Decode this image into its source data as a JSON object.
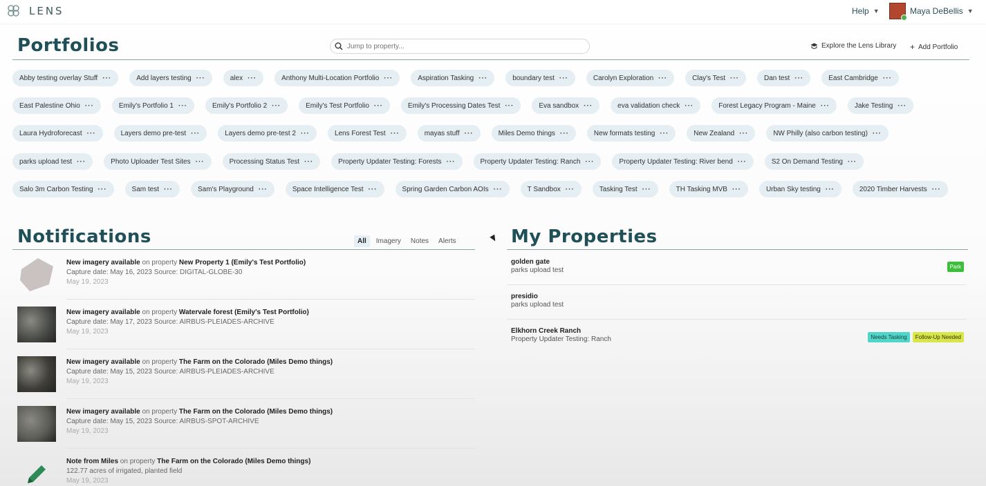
{
  "app": {
    "name": "LENS"
  },
  "topbar": {
    "help_label": "Help",
    "user_name": "Maya DeBellis"
  },
  "portfolios": {
    "title": "Portfolios",
    "search_placeholder": "Jump to property...",
    "library_label": "Explore the Lens Library",
    "add_label": "Add Portfolio",
    "rows": [
      [
        "Abby testing overlay Stuff",
        "Add layers testing",
        "alex",
        "Anthony Multi-Location Portfolio",
        "Aspiration Tasking",
        "boundary test",
        "Carolyn Exploration",
        "Clay's Test",
        "Dan test",
        "East Cambridge"
      ],
      [
        "East Palestine Ohio",
        "Emily's Portfolio 1",
        "Emily's Portfolio 2",
        "Emily's Test Portfolio",
        "Emily's Processing Dates Test",
        "Eva sandbox",
        "eva validation check",
        "Forest Legacy Program - Maine",
        "Jake Testing"
      ],
      [
        "Laura Hydroforecast",
        "Layers demo pre-test",
        "Layers demo pre-test 2",
        "Lens Forest Test",
        "mayas stuff",
        "Miles Demo things",
        "New formats testing",
        "New Zealand",
        "NW Philly (also carbon testing)"
      ],
      [
        "parks upload test",
        "Photo Uploader Test Sites",
        "Processing Status Test",
        "Property Updater Testing: Forests",
        "Property Updater Testing: Ranch",
        "Property Updater Testing: River bend",
        "S2 On Demand Testing"
      ],
      [
        "Salo 3m Carbon Testing",
        "Sam test",
        "Sam's Playground",
        "Space Intelligence Test",
        "Spring Garden Carbon AOIs",
        "T Sandbox",
        "Tasking Test",
        "TH Tasking MVB",
        "Urban Sky testing",
        "2020 Timber Harvests"
      ]
    ]
  },
  "notifications": {
    "title": "Notifications",
    "filters": [
      "All",
      "Imagery",
      "Notes",
      "Alerts"
    ],
    "items": [
      {
        "headline": "New imagery available",
        "connector": "on property",
        "property": "New Property 1 (Emily's Test Portfolio)",
        "line2_label": "Capture date:",
        "line2_value": "May 16, 2023",
        "source_label": "Source:",
        "source_value": "DIGITAL-GLOBE-30",
        "date": "May 19, 2023",
        "thumb_color": "#c9c2c0"
      },
      {
        "headline": "New imagery available",
        "connector": "on property",
        "property": "Watervale forest (Emily's Test Portfolio)",
        "line2_label": "Capture date:",
        "line2_value": "May 17, 2023",
        "source_label": "Source:",
        "source_value": "AIRBUS-PLEIADES-ARCHIVE",
        "date": "May 19, 2023",
        "thumb_color": "#4a4c49"
      },
      {
        "headline": "New imagery available",
        "connector": "on property",
        "property": "The Farm on the Colorado (Miles Demo things)",
        "line2_label": "Capture date:",
        "line2_value": "May 15, 2023",
        "source_label": "Source:",
        "source_value": "AIRBUS-PLEIADES-ARCHIVE",
        "date": "May 19, 2023",
        "thumb_color": "#3f3e38"
      },
      {
        "headline": "New imagery available",
        "connector": "on property",
        "property": "The Farm on the Colorado (Miles Demo things)",
        "line2_label": "Capture date:",
        "line2_value": "May 15, 2023",
        "source_label": "Source:",
        "source_value": "AIRBUS-SPOT-ARCHIVE",
        "date": "May 19, 2023",
        "thumb_color": "#5c5d57"
      },
      {
        "headline": "Note from Miles",
        "connector": "on property",
        "property": "The Farm on the Colorado (Miles Demo things)",
        "line2_label": "122.77 acres of irrigated, planted field",
        "line2_value": "",
        "source_label": "",
        "source_value": "",
        "date": "May 19, 2023",
        "thumb_color": ""
      }
    ]
  },
  "properties": {
    "title": "My Properties",
    "items": [
      {
        "name": "golden gate",
        "portfolio": "parks upload test",
        "tags": [
          {
            "label": "Park",
            "bg": "#3bbf3b",
            "fg": "#ffffff"
          }
        ]
      },
      {
        "name": "presidio",
        "portfolio": "parks upload test",
        "tags": []
      },
      {
        "name": "Elkhorn Creek Ranch",
        "portfolio": "Property Updater Testing: Ranch",
        "tags": [
          {
            "label": "Needs Tasking",
            "bg": "#4fd6c9",
            "fg": "#1c3c3c"
          },
          {
            "label": "Follow-Up Needed",
            "bg": "#d9e64a",
            "fg": "#333300"
          }
        ]
      }
    ]
  }
}
